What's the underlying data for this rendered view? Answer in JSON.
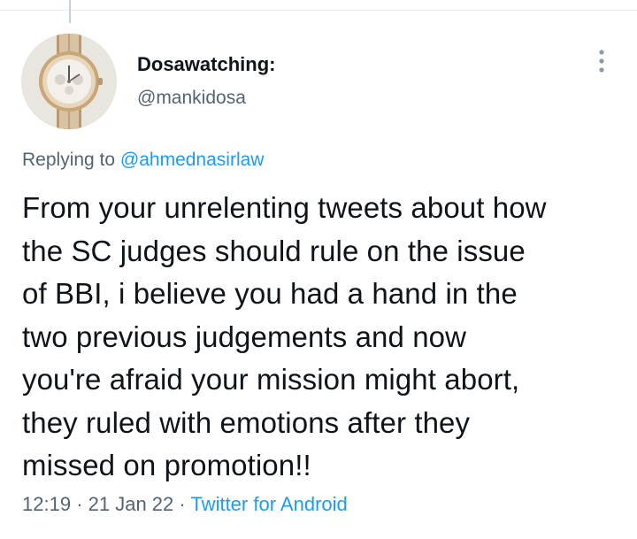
{
  "author": {
    "display_name": "Dosawatching:",
    "handle": "@mankidosa"
  },
  "reply": {
    "prefix": "Replying to",
    "mention": "@ahmednasirlaw"
  },
  "tweet": {
    "lines": [
      "From your unrelenting tweets about how",
      "the SC judges should rule on the issue",
      "of BBI, i believe you had a hand in the",
      "two previous judgements and now",
      "you're afraid your mission might abort,",
      "they ruled with emotions after they",
      "missed on promotion!!"
    ]
  },
  "meta": {
    "time": "12:19",
    "date": "21 Jan 22",
    "separator": "·",
    "source": "Twitter for Android"
  },
  "icons": {
    "more": "more-vertical-icon",
    "avatar": "wristwatch-avatar"
  },
  "colors": {
    "link": "#1d9bf0",
    "secondary_text": "#536471",
    "primary_text": "#0f1419"
  }
}
